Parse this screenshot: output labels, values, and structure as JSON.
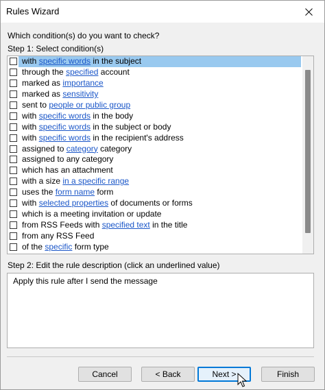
{
  "window": {
    "title": "Rules Wizard"
  },
  "prompt": "Which condition(s) do you want to check?",
  "step1_label": "Step 1: Select condition(s)",
  "conditions": [
    {
      "parts": [
        {
          "t": "with "
        },
        {
          "t": "specific words",
          "link": true
        },
        {
          "t": " in the subject"
        }
      ],
      "selected": true
    },
    {
      "parts": [
        {
          "t": "through the "
        },
        {
          "t": "specified",
          "link": true
        },
        {
          "t": " account"
        }
      ]
    },
    {
      "parts": [
        {
          "t": "marked as "
        },
        {
          "t": "importance",
          "link": true
        }
      ]
    },
    {
      "parts": [
        {
          "t": "marked as "
        },
        {
          "t": "sensitivity",
          "link": true
        }
      ]
    },
    {
      "parts": [
        {
          "t": "sent to "
        },
        {
          "t": "people or public group",
          "link": true
        }
      ]
    },
    {
      "parts": [
        {
          "t": "with "
        },
        {
          "t": "specific words",
          "link": true
        },
        {
          "t": " in the body"
        }
      ]
    },
    {
      "parts": [
        {
          "t": "with "
        },
        {
          "t": "specific words",
          "link": true
        },
        {
          "t": " in the subject or body"
        }
      ]
    },
    {
      "parts": [
        {
          "t": "with "
        },
        {
          "t": "specific words",
          "link": true
        },
        {
          "t": " in the recipient's address"
        }
      ]
    },
    {
      "parts": [
        {
          "t": "assigned to "
        },
        {
          "t": "category",
          "link": true
        },
        {
          "t": " category"
        }
      ]
    },
    {
      "parts": [
        {
          "t": "assigned to any category"
        }
      ]
    },
    {
      "parts": [
        {
          "t": "which has an attachment"
        }
      ]
    },
    {
      "parts": [
        {
          "t": "with a size "
        },
        {
          "t": "in a specific range",
          "link": true
        }
      ]
    },
    {
      "parts": [
        {
          "t": "uses the "
        },
        {
          "t": "form name",
          "link": true
        },
        {
          "t": " form"
        }
      ]
    },
    {
      "parts": [
        {
          "t": "with "
        },
        {
          "t": "selected properties",
          "link": true
        },
        {
          "t": " of documents or forms"
        }
      ]
    },
    {
      "parts": [
        {
          "t": "which is a meeting invitation or update"
        }
      ]
    },
    {
      "parts": [
        {
          "t": "from RSS Feeds with "
        },
        {
          "t": "specified text",
          "link": true
        },
        {
          "t": " in the title"
        }
      ]
    },
    {
      "parts": [
        {
          "t": "from any RSS Feed"
        }
      ]
    },
    {
      "parts": [
        {
          "t": "of the "
        },
        {
          "t": "specific",
          "link": true
        },
        {
          "t": " form type"
        }
      ]
    }
  ],
  "step2_label": "Step 2: Edit the rule description (click an underlined value)",
  "description": "Apply this rule after I send the message",
  "buttons": {
    "cancel": "Cancel",
    "back": "< Back",
    "next": "Next >",
    "finish": "Finish"
  },
  "colors": {
    "link": "#1a56c8",
    "selection": "#99c9ef",
    "default_button_border": "#0078d7"
  }
}
